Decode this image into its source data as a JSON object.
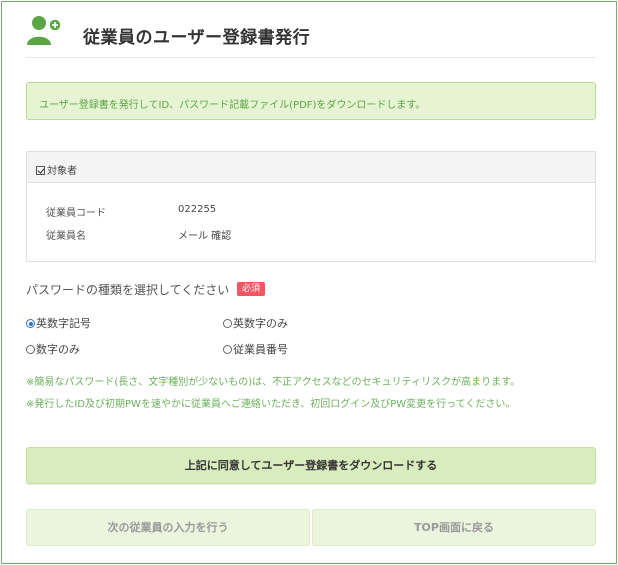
{
  "header": {
    "title": "従業員のユーザー登録書発行",
    "icon": "user-add-icon",
    "accent_color": "#5aa544"
  },
  "notice": {
    "text": "ユーザー登録書を発行してID、パスワード記載ファイル(PDF)をダウンロードします。"
  },
  "target_panel": {
    "heading": "対象者",
    "rows": [
      {
        "label": "従業員コード",
        "value": "022255"
      },
      {
        "label": "従業員名",
        "value": "メール 確認"
      }
    ]
  },
  "password_type": {
    "label": "パスワードの種類を選択してください",
    "required_badge": "必須",
    "options": [
      {
        "label": "英数字記号",
        "selected": true
      },
      {
        "label": "英数字のみ",
        "selected": false
      },
      {
        "label": "数字のみ",
        "selected": false
      },
      {
        "label": "従業員番号",
        "selected": false
      }
    ]
  },
  "warnings": [
    "※簡易なパスワード(長さ、文字種別が少ないもの)は、不正アクセスなどのセキュリティリスクが高まります。",
    "※発行したID及び初期PWを速やかに従業員へご連絡いただき、初回ログイン及びPW変更を行ってください。"
  ],
  "buttons": {
    "download": "上記に同意してユーザー登録書をダウンロードする",
    "next_employee": "次の従業員の入力を行う",
    "back_top": "TOP画面に戻る"
  }
}
